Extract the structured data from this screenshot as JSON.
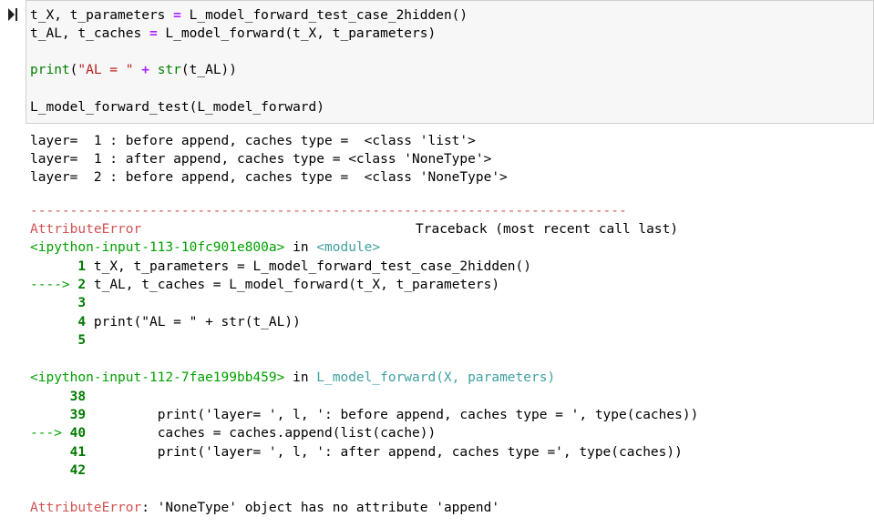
{
  "input_cell": {
    "lines": [
      {
        "a": "t_X, t_parameters ",
        "b": "=",
        "c": " L_model_forward_test_case_2hidden()"
      },
      {
        "a": "t_AL, t_caches ",
        "b": "=",
        "c": " L_model_forward(t_X, t_parameters)"
      },
      {
        "fn": "print",
        "p1": "(",
        "s": "\"AL = \"",
        "op": " + ",
        "fn2": "str",
        "rest": "(t_AL))"
      },
      {
        "text": "L_model_forward_test(L_model_forward)"
      }
    ]
  },
  "output": {
    "stdout": [
      "layer=  1 : before append, caches type =  <class 'list'>",
      "layer=  1 : after append, caches type = <class 'NoneType'>",
      "layer=  2 : before append, caches type =  <class 'NoneType'>"
    ],
    "separator": "---------------------------------------------------------------------------",
    "error_name": "AttributeError",
    "traceback_header": "Traceback (most recent call last)",
    "frame1": {
      "file": "<ipython-input-113-10fc901e800a>",
      "in_word": " in ",
      "location": "<module>",
      "lines": [
        {
          "arrow": "      ",
          "num": "1",
          "code": " t_X, t_parameters = L_model_forward_test_case_2hidden()"
        },
        {
          "arrow": "----> ",
          "num": "2",
          "code": " t_AL, t_caches = L_model_forward(t_X, t_parameters)"
        },
        {
          "arrow": "      ",
          "num": "3",
          "code": ""
        },
        {
          "arrow": "      ",
          "num": "4",
          "code": " print(\"AL = \" + str(t_AL))"
        },
        {
          "arrow": "      ",
          "num": "5",
          "code": ""
        }
      ]
    },
    "frame2": {
      "file": "<ipython-input-112-7fae199bb459>",
      "in_word": " in ",
      "location": "L_model_forward(X, parameters)",
      "lines": [
        {
          "arrow": "     ",
          "num": "38",
          "code": ""
        },
        {
          "arrow": "     ",
          "num": "39",
          "code": "         print('layer= ', l, ': before append, caches type = ', type(caches))"
        },
        {
          "arrow": "---> ",
          "num": "40",
          "code": "         caches = caches.append(list(cache))"
        },
        {
          "arrow": "     ",
          "num": "41",
          "code": "         print('layer= ', l, ': after append, caches type =', type(caches))"
        },
        {
          "arrow": "     ",
          "num": "42",
          "code": ""
        }
      ]
    },
    "final_error": {
      "name": "AttributeError",
      "message": ": 'NoneType' object has no attribute 'append'"
    }
  }
}
